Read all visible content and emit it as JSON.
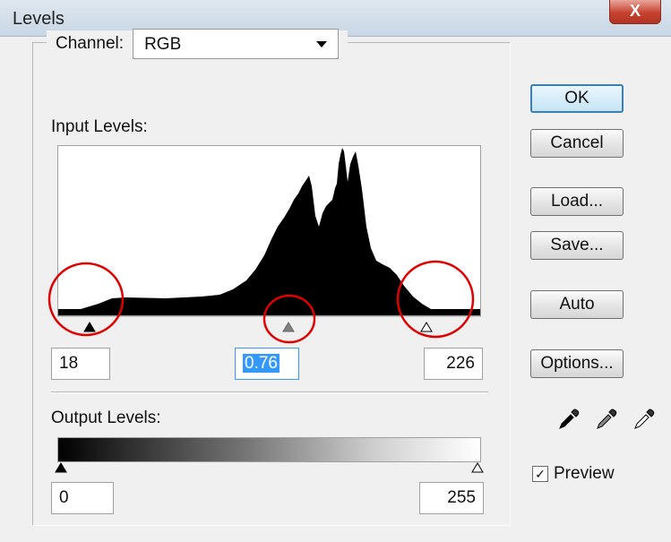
{
  "window": {
    "title": "Levels",
    "close_label": "X"
  },
  "channel": {
    "label": "Channel:",
    "value": "RGB"
  },
  "input_levels": {
    "label": "Input Levels:",
    "black": "18",
    "midtone": "0.76",
    "white": "226",
    "black_point": 18,
    "gamma": 0.76,
    "white_point": 226
  },
  "output_levels": {
    "label": "Output Levels:",
    "black": "0",
    "white": "255"
  },
  "buttons": {
    "ok": "OK",
    "cancel": "Cancel",
    "load": "Load...",
    "save": "Save...",
    "auto": "Auto",
    "options": "Options..."
  },
  "eyedroppers": [
    "black-eyedropper-icon",
    "gray-eyedropper-icon",
    "white-eyedropper-icon"
  ],
  "preview": {
    "label": "Preview",
    "checked": true
  },
  "annotations": {
    "circle_color": "#e00000"
  },
  "colors": {
    "ok_border": "#3c7fb1",
    "selection": "#3399ff"
  }
}
